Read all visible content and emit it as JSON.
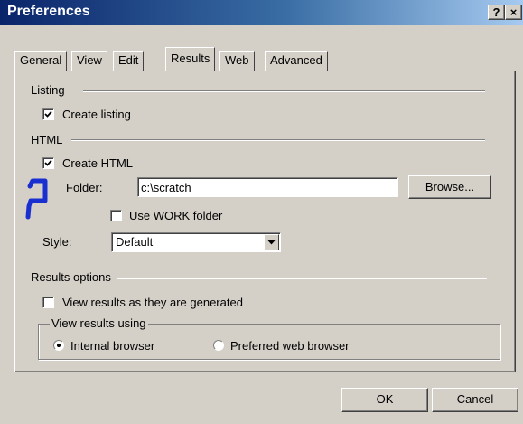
{
  "window": {
    "title": "Preferences",
    "help_label": "?",
    "close_label": "×"
  },
  "tabs": [
    "General",
    "View",
    "Edit",
    "Results",
    "Web",
    "Advanced"
  ],
  "active_tab": "Results",
  "listing": {
    "heading": "Listing",
    "create_listing_label": "Create listing",
    "create_listing_checked": true
  },
  "html": {
    "heading": "HTML",
    "create_html_label": "Create HTML",
    "create_html_checked": true,
    "folder_label": "Folder:",
    "folder_value": "c:\\scratch",
    "browse_label": "Browse...",
    "use_work_label": "Use WORK folder",
    "use_work_checked": false,
    "style_label": "Style:",
    "style_value": "Default"
  },
  "results_options": {
    "heading": "Results options",
    "view_as_generated_label": "View results as they are generated",
    "view_as_generated_checked": false,
    "view_using_legend": "View results using",
    "internal_label": "Internal browser",
    "internal_selected": true,
    "preferred_label": "Preferred web browser",
    "preferred_selected": false
  },
  "buttons": {
    "ok_label": "OK",
    "cancel_label": "Cancel"
  },
  "colors": {
    "face": "#d4d0c8",
    "title_start": "#0a246a",
    "title_end": "#a6caf0",
    "annotation": "#1a2fd0"
  },
  "annotation_icon": "blue-bracket-mark"
}
